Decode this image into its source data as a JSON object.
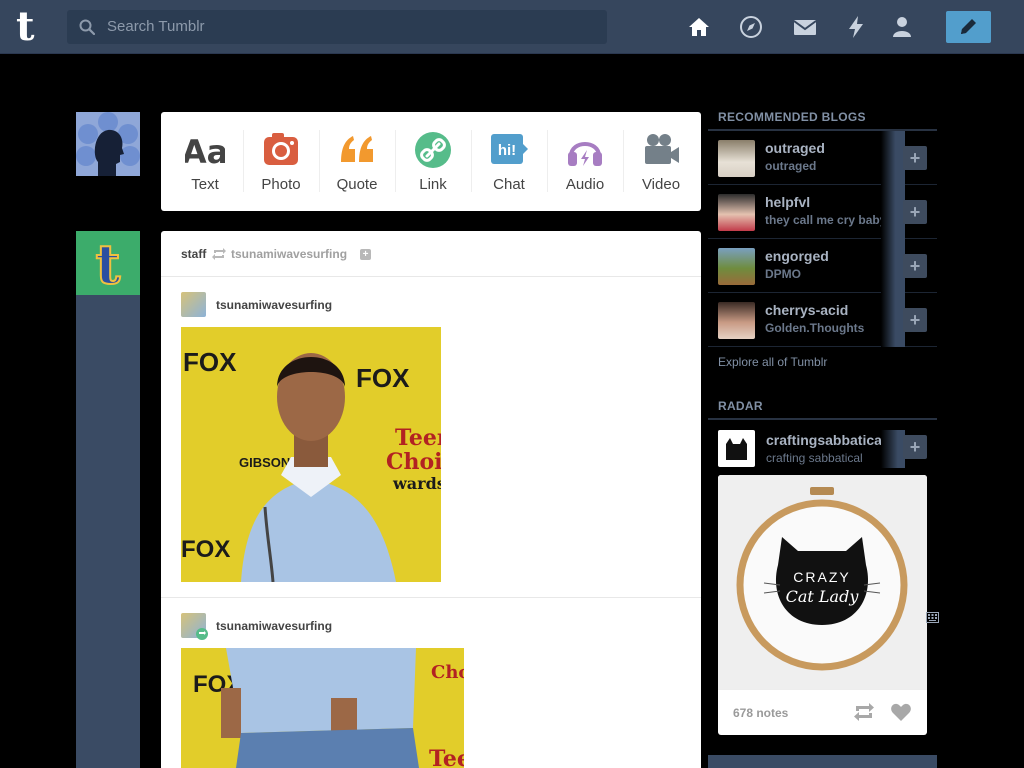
{
  "header": {
    "logo": "t",
    "search_placeholder": "Search Tumblr",
    "nav_icons": [
      "home-icon",
      "explore-icon",
      "inbox-icon",
      "activity-icon",
      "account-icon"
    ],
    "compose_icon": "pencil-icon",
    "colors": {
      "bar": "#36465d",
      "search": "#2b3c52",
      "compose": "#529ecc",
      "page": "#000000"
    }
  },
  "composer": {
    "types": [
      {
        "label": "Text",
        "icon": "text-icon",
        "color": "#444444"
      },
      {
        "label": "Photo",
        "icon": "camera-icon",
        "color": "#d95e40"
      },
      {
        "label": "Quote",
        "icon": "quote-icon",
        "color": "#f2992e"
      },
      {
        "label": "Link",
        "icon": "link-icon",
        "color": "#56bc8a"
      },
      {
        "label": "Chat",
        "icon": "chat-icon",
        "color": "#529ecc"
      },
      {
        "label": "Audio",
        "icon": "headphones-icon",
        "color": "#a77dc2"
      },
      {
        "label": "Video",
        "icon": "video-camera-icon",
        "color": "#748089"
      }
    ]
  },
  "post": {
    "reblogger": "staff",
    "reblogged_from": "tsunamiwavesurfing",
    "posts": [
      {
        "user": "tsunamiwavesurfing"
      },
      {
        "user": "tsunamiwavesurfing"
      }
    ],
    "photo_text": {
      "brand": "FOX",
      "sponsor": "GIBSON",
      "event_lines": [
        "Teen",
        "Choice",
        "wards"
      ]
    }
  },
  "sidebar": {
    "recommended_heading": "RECOMMENDED BLOGS",
    "blogs": [
      {
        "name": "outraged",
        "subtitle": "outraged"
      },
      {
        "name": "helpfvl",
        "subtitle": "they call me cry baby"
      },
      {
        "name": "engorged",
        "subtitle": "DPMO"
      },
      {
        "name": "cherrys-acid",
        "subtitle": "Golden.Thoughts"
      }
    ],
    "follow_label": "+",
    "explore_link": "Explore all of Tumblr",
    "radar_heading": "RADAR",
    "radar": {
      "name": "craftingsabbatical",
      "subtitle": "crafting sabbatical",
      "image_text": [
        "CRAZY",
        "Cat Lady"
      ],
      "notes": "678 notes"
    }
  }
}
